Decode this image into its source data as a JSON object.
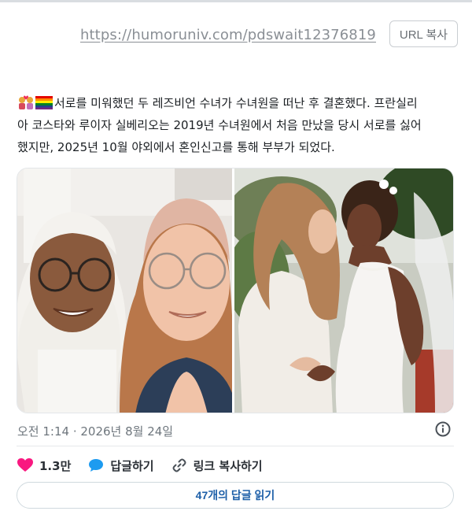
{
  "url_bar": {
    "link": "https://humoruniv.com/pdswait12376819",
    "copy_label": "URL 복사"
  },
  "tweet": {
    "emojis": [
      "women-couple-with-heart",
      "rainbow-flag"
    ],
    "line1": "서로를 미워했던 두 레즈비언 수녀가 수녀원을 떠난 후 결혼했다. 프란실리",
    "line2": "아 코스타와 루이자 실베리오는 2019년 수녀원에서 처음 만났을 당시 서로를 싫어",
    "line3": "했지만, 2025년 10월 야외에서 혼인신고를 통해 부부가 되었다."
  },
  "media": {
    "photos": [
      {
        "description_icon": "selfie-photo"
      },
      {
        "description_icon": "wedding-photo"
      }
    ]
  },
  "meta": {
    "timestamp": "오전 1:14 · 2026년 8월 24일"
  },
  "actions": {
    "likes": "1.3만",
    "reply": "답글하기",
    "copy_link": "링크 복사하기"
  },
  "replies": {
    "read_label": "47개의 답글 읽기"
  },
  "colors": {
    "heart": "#f91880",
    "reply_bubble": "#1d9bf0",
    "link_text": "#1d5fa8"
  }
}
